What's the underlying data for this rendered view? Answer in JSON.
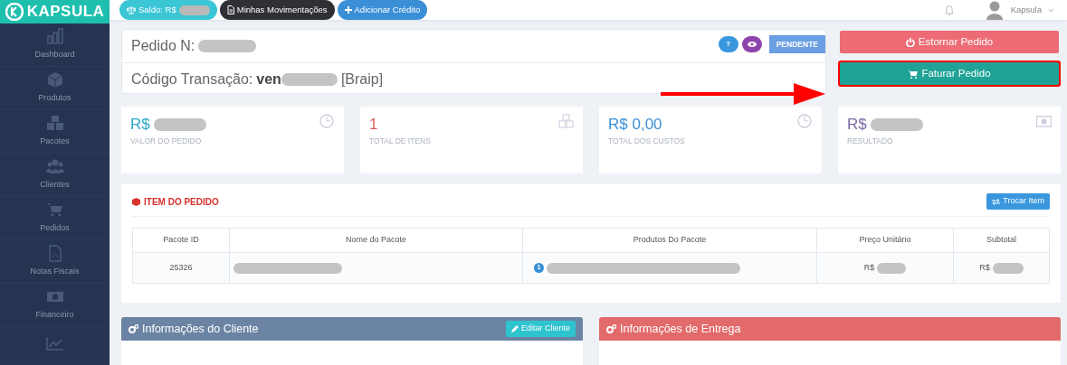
{
  "brand": "KAPSULA",
  "topbar": {
    "balance_label": "Saldo: R$",
    "buttons": [
      {
        "label": "Minhas Movimentações",
        "kind": "dark"
      },
      {
        "label": "Adicionar Crédito",
        "kind": "add"
      }
    ],
    "user": "Kapsula"
  },
  "sidebar": {
    "items": [
      {
        "label": "Dashboard"
      },
      {
        "label": "Produtos"
      },
      {
        "label": "Pacotes"
      },
      {
        "label": "Clientes"
      },
      {
        "label": "Pedidos"
      },
      {
        "label": "Notas Fiscais"
      },
      {
        "label": "Financeiro"
      }
    ]
  },
  "order": {
    "number_label": "Pedido N:",
    "code_label": "Código Transação:",
    "code": "ven",
    "code_suffix": "[Braip]",
    "badges": [
      {
        "text": "?",
        "color": "#3a97de"
      },
      {
        "kind": "eye",
        "color": "#8e44ad"
      }
    ],
    "status": "PENDENTE"
  },
  "actions": [
    {
      "label": "Estornar Pedido",
      "kind": "danger",
      "highlighted": false
    },
    {
      "label": "Faturar Pedido",
      "kind": "success",
      "highlighted": true
    }
  ],
  "stats": [
    {
      "value": "R$",
      "label": "VALOR DO PEDIDO",
      "color": "#2aa9c9",
      "redacted": true
    },
    {
      "value": "1",
      "label": "TOTAL DE ITENS",
      "color": "#e0605d",
      "redacted": false
    },
    {
      "value": "R$ 0,00",
      "label": "TOTAL DOS CUSTOS",
      "color": "#3b8fd6",
      "redacted": false
    },
    {
      "value": "R$",
      "label": "RESULTADO",
      "color": "#7c6aa6",
      "redacted": true
    }
  ],
  "items_panel": {
    "title": "ITEM DO PEDIDO",
    "button": "Trocar Item",
    "table": {
      "columns": [
        "Pacote ID",
        "Nome do Pacote",
        "Produtos Do Pacote",
        "Preço Unitário",
        "Subtotal"
      ],
      "rows": [
        {
          "pacote_id": "25326",
          "produtos_count": "1",
          "preco_prefix": "R$",
          "subtotal_prefix": "R$"
        }
      ]
    }
  },
  "panels": [
    {
      "title": "Informações do Cliente",
      "button": "Editar Cliente",
      "color": "#6b84a3"
    },
    {
      "title": "Informações de Entrega",
      "color": "#e26a6a"
    }
  ]
}
